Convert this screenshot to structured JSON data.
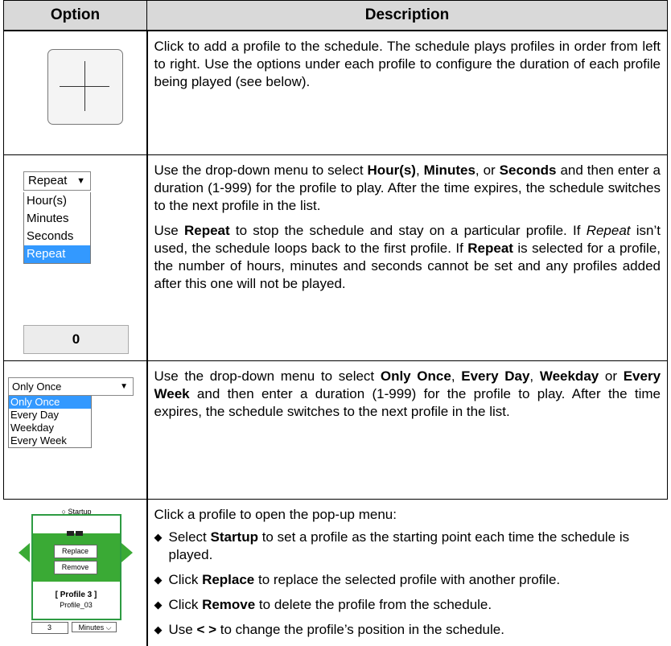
{
  "table": {
    "headers": {
      "option": "Option",
      "description": "Description"
    }
  },
  "row1": {
    "plus_icon": "plus-icon",
    "text": "Click to add a profile to the schedule. The schedule plays profiles in order from left to right. Use the options under each profile to configure the duration of each profile being played (see below)."
  },
  "row2": {
    "dropdown": {
      "selected": "Repeat",
      "options": [
        "Hour(s)",
        "Minutes",
        "Seconds",
        "Repeat"
      ],
      "highlighted": "Repeat"
    },
    "number_value": "0",
    "p1": {
      "a": "Use the drop-down menu to select ",
      "b": "Hour(s)",
      "c": ", ",
      "d": "Minutes",
      "e": ", or ",
      "f": "Seconds",
      "g": " and then enter a duration (1-999) for the profile to play. After the time expires, the schedule switches to the next profile in the list."
    },
    "p2": {
      "a": "Use ",
      "b": "Repeat",
      "c": " to stop the schedule and stay on a particular profile. If ",
      "d": "Repeat",
      "e": " isn’t used, the schedule loops back to the first profile. If ",
      "f": "Repeat",
      "g": " is selected for a profile, the number of hours, minutes and seconds cannot be set and any profiles added after this one will not be played."
    }
  },
  "row3": {
    "dropdown": {
      "selected": "Only Once",
      "options": [
        "Only Once",
        "Every Day",
        "Weekday",
        "Every Week"
      ],
      "highlighted": "Only Once"
    },
    "p1": {
      "a": "Use the drop-down menu to select ",
      "b": "Only Once",
      "c": ", ",
      "d": "Every Day",
      "e": ", ",
      "f": "Weekday",
      "g": " or ",
      "h": "Every Week",
      "i": " and then enter a duration (1-999) for the profile to play. After the time expires, the schedule switches to the next profile in the list."
    }
  },
  "row4": {
    "card": {
      "startup_label": "Startup",
      "replace_label": "Replace",
      "remove_label": "Remove",
      "profile_name": "[ Profile 3 ]",
      "profile_file": "Profile_03",
      "duration_value": "3",
      "duration_unit": "Minutes",
      "accent_color": "#3aaa35"
    },
    "intro": "Click a profile to open the pop-up menu:",
    "bullet_glyph": "◆",
    "bullets": [
      {
        "a": "Select ",
        "b": "Startup",
        "c": " to set a profile as the starting point each time the schedule is played."
      },
      {
        "a": "Click ",
        "b": "Replace",
        "c": " to replace the selected profile with another profile."
      },
      {
        "a": "Click ",
        "b": "Remove",
        "c": " to delete the profile from the schedule."
      },
      {
        "a": "Use ",
        "b": "< >",
        "c": " to change the profile’s position in the schedule."
      }
    ]
  }
}
